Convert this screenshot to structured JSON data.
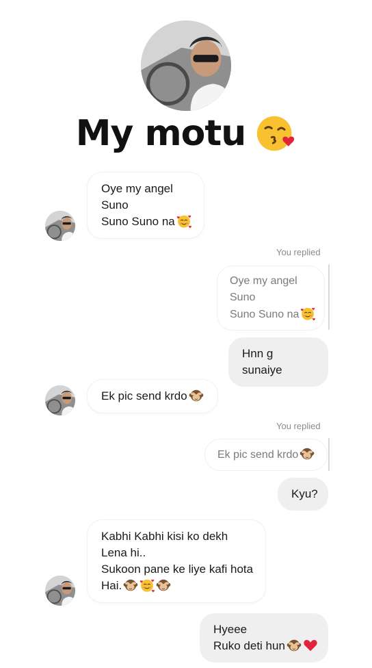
{
  "chat": {
    "contact_name": "My motu",
    "messages": [
      {
        "from": "them",
        "lines": [
          "Oye my angel",
          "Suno",
          "Suno Suno na"
        ]
      },
      {
        "from": "me",
        "replied_label": "You replied",
        "quoted_lines": [
          "Oye my angel",
          "Suno",
          "Suno Suno na"
        ],
        "text": "Hnn g sunaiye"
      },
      {
        "from": "them",
        "lines": [
          "Ek pic send krdo"
        ]
      },
      {
        "from": "me",
        "replied_label": "You replied",
        "quoted_lines": [
          "Ek pic send krdo"
        ],
        "text": "Kyu?"
      },
      {
        "from": "them",
        "lines": [
          "Kabhi Kabhi kisi ko dekh",
          "Lena hi..",
          "Sukoon pane ke liye kafi hota",
          "Hai."
        ]
      },
      {
        "from": "me",
        "lines": [
          "Hyeee",
          "Ruko deti hun"
        ]
      }
    ]
  },
  "icons": {
    "title_emoji": "face-blowing-kiss-icon",
    "smiling_hearts": "smiling-face-with-hearts-icon",
    "monkey": "see-no-evil-monkey-icon",
    "heart": "red-heart-icon"
  },
  "colors": {
    "background": "#ffffff",
    "outgoing_bubble": "#efefef",
    "muted_text": "#8a8a8a",
    "heart": "#e0243c",
    "emoji_yellow": "#f7c12f"
  }
}
